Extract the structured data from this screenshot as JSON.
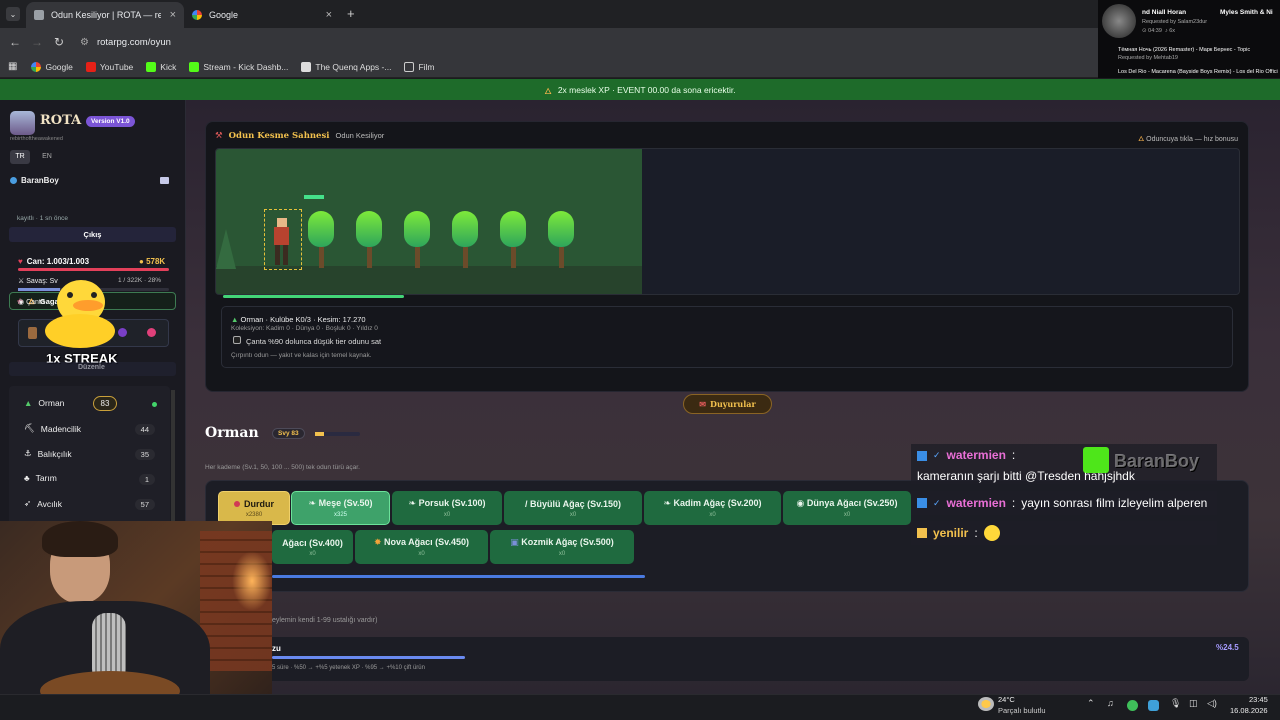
{
  "browser": {
    "tabs": [
      {
        "title": "Odun Kesiliyor | ROTA — re",
        "active": true
      },
      {
        "title": "Google",
        "active": false
      }
    ],
    "url": "rotarpg.com/oyun",
    "bookmarks": [
      "Google",
      "YouTube",
      "Kick",
      "Stream - Kick Dashb...",
      "The Quenq Apps -...",
      "Film"
    ]
  },
  "music": {
    "now_title": "nd Niall Horan",
    "artist": "Myles Smith & Ni",
    "requested": "Requested by Salam23dur",
    "time": "04:39",
    "queue_count": "6x",
    "q1": "Тёмная Ночь (2026 Remaster) - Марк Бернес - Topic",
    "q1_req": "Requested by Mehtab19",
    "q2": "Los Del Rio - Macarena (Bayside Boys Remix) - Los del Rio Official"
  },
  "banner": "2x meslek XP · EVENT 00.00 da sona ericektir.",
  "sidebar": {
    "logo": "ROTA",
    "version": "Version V1.0",
    "tagline": "rebirthoftheawakened",
    "lang_tr": "TR",
    "lang_en": "EN",
    "username": "BaranBoy",
    "event": "Gaga Fırtınası",
    "saved": "kayıtlı · 1 sn önce",
    "logout": "Çıkış",
    "hp": "Can: 1.003/1.003",
    "gold": "578K",
    "war": "Savaş: Sv",
    "war_xp": "1 / 322K · 28%",
    "bag": "Çanta",
    "streak": "1x STREAK",
    "edit": "Düzenle",
    "skills": [
      {
        "name": "Orman",
        "level": "83"
      },
      {
        "name": "Madencilik",
        "level": "44"
      },
      {
        "name": "Balıkçılık",
        "level": "35"
      },
      {
        "name": "Tarım",
        "level": "1"
      },
      {
        "name": "Avcılık",
        "level": "57"
      }
    ]
  },
  "scene": {
    "title": "Odun Kesme Sahnesi",
    "subtitle": "Odun Kesiliyor",
    "hint": "Oduncuya tıkla — hız bonusu",
    "info_title": "Orman · Kulübe K0/3 · Kesim: 17.270",
    "info_sub": "Koleksiyon: Kadim 0 · Dünya 0 · Boşluk 0 · Yıldız 0",
    "checkbox_label": "Çanta %90 dolunca düşük tier odunu sat",
    "desc": "Çırpıntı odun — yakıt ve kalas için temel kaynak.",
    "chop_progress": 0.5
  },
  "announce": "Duyurular",
  "section": {
    "title": "Orman",
    "level": "Svy 83",
    "desc": "Her kademe (Sv.1, 50, 100 ... 500) tek odun türü açar.",
    "footer1": "eylemin kendi 1-99 ustalığı vardır)",
    "footer_label": "zu",
    "footer_pct": "%24.5",
    "footer_sub": "5 süre · %50 → +%5 yetenek XP · %95 → +%10 çift ürün"
  },
  "trees": [
    {
      "name": "Durdur",
      "count": "x2380"
    },
    {
      "name": "Meşe (Sv.50)",
      "count": "x325"
    },
    {
      "name": "Porsuk (Sv.100)",
      "count": "x0"
    },
    {
      "name": "Büyülü Ağaç (Sv.150)",
      "count": "x0"
    },
    {
      "name": "Kadim Ağaç (Sv.200)",
      "count": "x0"
    },
    {
      "name": "Dünya Ağacı (Sv.250)",
      "count": "x0"
    },
    {
      "name": "Ağacı (Sv.400)",
      "count": "x0"
    },
    {
      "name": "Nova Ağacı (Sv.450)",
      "count": "x0"
    },
    {
      "name": "Kozmik Ağaç (Sv.500)",
      "count": "x0"
    }
  ],
  "chat": [
    {
      "user": "watermien",
      "msg": "kameranın şarjı bitti @Tresden hahjsjhdk"
    },
    {
      "user": "watermien",
      "msg": "yayın sonrası film izleyelim alperen"
    },
    {
      "user": "yenilir",
      "msg": ""
    }
  ],
  "overlay_name": "BaranBoy",
  "weather": {
    "temp": "24°C",
    "desc": "Parçalı bulutlu"
  },
  "clock": {
    "time": "23:45",
    "date": "16.08.2026"
  }
}
